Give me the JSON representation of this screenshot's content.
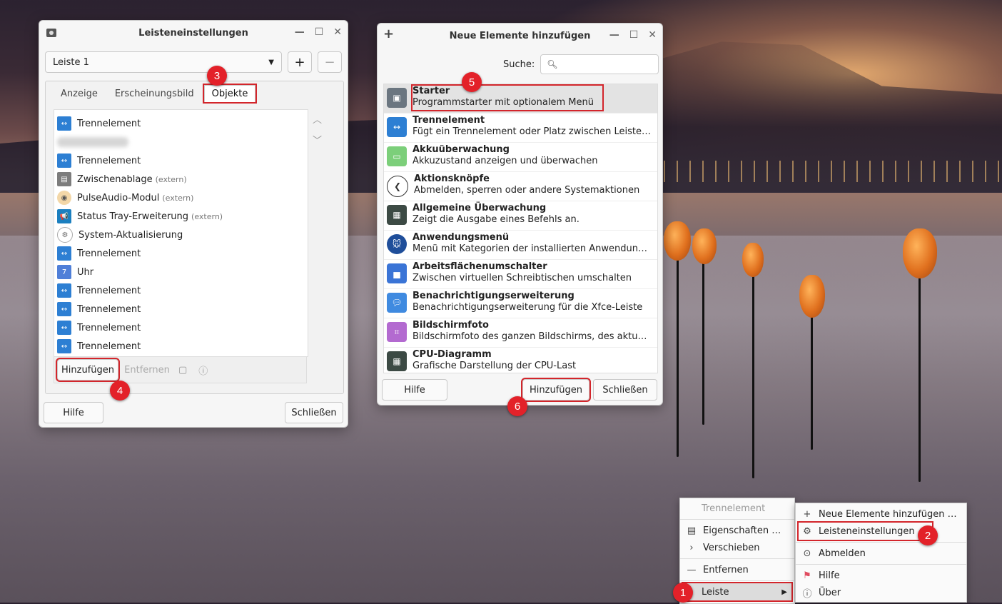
{
  "settings_window": {
    "title": "Leisteneinstellungen",
    "panel_select": "Leiste 1",
    "tabs": [
      "Anzeige",
      "Erscheinungsbild",
      "Objekte"
    ],
    "items": [
      {
        "label": "Trennelement",
        "extra": ""
      },
      {
        "label": "",
        "extra": ""
      },
      {
        "label": "Trennelement",
        "extra": ""
      },
      {
        "label": "Zwischenablage",
        "extra": "(extern)"
      },
      {
        "label": "PulseAudio-Modul",
        "extra": "(extern)"
      },
      {
        "label": "Status Tray-Erweiterung",
        "extra": "(extern)"
      },
      {
        "label": "System-Aktualisierung",
        "extra": ""
      },
      {
        "label": "Trennelement",
        "extra": ""
      },
      {
        "label": "Uhr",
        "extra": ""
      },
      {
        "label": "Trennelement",
        "extra": ""
      },
      {
        "label": "Trennelement",
        "extra": ""
      },
      {
        "label": "Trennelement",
        "extra": ""
      },
      {
        "label": "Trennelement",
        "extra": ""
      }
    ],
    "add_label": "Hinzufügen",
    "remove_label": "Entfernen",
    "help_label": "Hilfe",
    "close_label": "Schließen",
    "plus_label": "+",
    "minus_label": "−"
  },
  "add_window": {
    "title": "Neue Elemente hinzufügen",
    "search_label": "Suche:",
    "elements": [
      {
        "title": "Starter",
        "desc": "Programmstarter mit optionalem Menü",
        "color": "#6b7680"
      },
      {
        "title": "Trennelement",
        "desc": "Fügt ein Trennelement oder Platz zwischen Leistenelementen ein",
        "color": "#2d7fd3"
      },
      {
        "title": "Akkuüberwachung",
        "desc": "Akkuzustand anzeigen und überwachen",
        "color": "#7ccf7a"
      },
      {
        "title": "Aktionsknöpfe",
        "desc": "Abmelden, sperren oder andere Systemaktionen",
        "color": "#ffffff"
      },
      {
        "title": "Allgemeine Überwachung",
        "desc": "Zeigt die Ausgabe eines Befehls an.",
        "color": "#3c4a44"
      },
      {
        "title": "Anwendungsmenü",
        "desc": "Menü mit Kategorien der installierten Anwendungen anzeigen",
        "color": "#1f4e9a"
      },
      {
        "title": "Arbeitsflächenumschalter",
        "desc": "Zwischen virtuellen Schreibtischen umschalten",
        "color": "#3a74d6"
      },
      {
        "title": "Benachrichtigungserweiterung",
        "desc": "Benachrichtigungserweiterung für die Xfce-Leiste",
        "color": "#3f8ae0"
      },
      {
        "title": "Bildschirmfoto",
        "desc": "Bildschirmfoto des ganzen Bildschirms, des aktuellen Fensters",
        "color": "#b36ad0"
      },
      {
        "title": "CPU-Diagramm",
        "desc": "Grafische Darstellung der CPU-Last",
        "color": "#3c4a44"
      }
    ],
    "help_label": "Hilfe",
    "add_label": "Hinzufügen",
    "close_label": "Schließen"
  },
  "context_menu": {
    "items": [
      {
        "label": "Trennelement",
        "icon": "",
        "disabled": true
      },
      {
        "label": "Eigenschaften …",
        "icon": "properties-icon"
      },
      {
        "label": "Verschieben",
        "icon": "chevron-right-icon"
      },
      {
        "label": "Entfernen",
        "icon": "minus-icon"
      },
      {
        "label": "Leiste",
        "icon": ""
      }
    ]
  },
  "submenu": {
    "items": [
      {
        "label": "Neue Elemente hinzufügen …",
        "icon": "plus-icon"
      },
      {
        "label": "Leisteneinstellungen …",
        "icon": "gear-icon"
      },
      {
        "label": "Abmelden",
        "icon": "logout-icon"
      },
      {
        "label": "Hilfe",
        "icon": "help-icon"
      },
      {
        "label": "Über",
        "icon": "info-icon"
      }
    ]
  },
  "markers": [
    "1",
    "2",
    "3",
    "4",
    "5",
    "6"
  ],
  "colors": {
    "marker": "#e32129",
    "highlight_box": "#d3252b"
  }
}
